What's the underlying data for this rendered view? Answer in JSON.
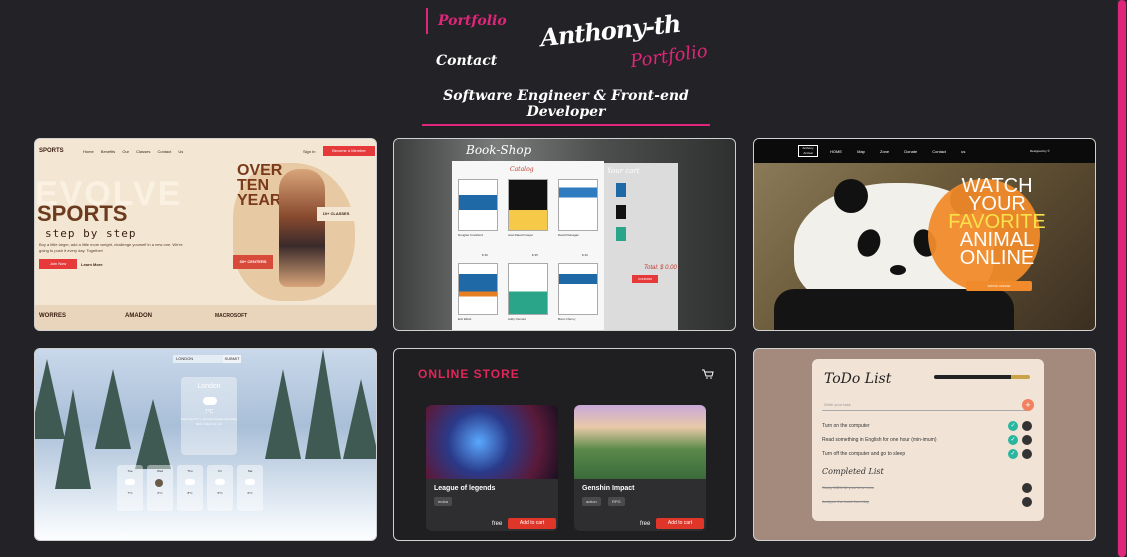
{
  "nav": {
    "portfolio": "Portfolio",
    "contact": "Contact"
  },
  "logo": {
    "main": "Anthony-th",
    "sub": "Portfolio"
  },
  "tagline": "Software Engineer & Front-end Developer",
  "colors": {
    "accent": "#e0267a",
    "background": "#232226"
  },
  "sports": {
    "brand": "SPORTS",
    "links": "Home Benefits Our Classes Contact Us",
    "signin": "Sign In",
    "member": "Become a Member",
    "evolve": "EVOLVE",
    "title": "SPORTS",
    "step": "step by step",
    "para": "Buy a little larger, add a little more weight, challenge yourself in a new one. We're going to push it every day. Together!",
    "join": "Join Now",
    "learn": "Learn More",
    "over": "OVER TEN YEARS",
    "classes": "10+ CLASSES",
    "centers": "30+ CENTERS",
    "brands": [
      "WORRES",
      "AMADON",
      "MACROSOFT"
    ]
  },
  "bookshop": {
    "title": "Book-Shop",
    "catalog": "Catalog",
    "cart_title": "Your cart",
    "books": [
      {
        "author": "Douglas Crockford",
        "title": "JavaScript: The Good Parts",
        "price": "$ 30"
      },
      {
        "author": "Axel Rauschmayer",
        "title": "Speaking JavaScript",
        "price": "$ 35"
      },
      {
        "author": "David Flanagan",
        "title": "HTTP: The Definitive Guide",
        "price": "$ 40"
      },
      {
        "author": "Eric Elliott",
        "title": "Programming JavaScript Applications",
        "price": "$ 25"
      },
      {
        "author": "Addy Osmani",
        "title": "Learning JavaScript Design Patterns",
        "price": "$ 30"
      },
      {
        "author": "Boris Cherny",
        "title": "Programming TypeScript",
        "price": "$ 40"
      }
    ],
    "total": "Total: $ 0.00",
    "checkout": "CONFIRM"
  },
  "panda": {
    "logo": "Anthony Animal",
    "links": "HOME Map Zone Donate Contact us",
    "designed": "Designed by ©",
    "line1": "WATCH",
    "line2": "YOUR",
    "line3": "FAVORITE",
    "line4": "ANIMAL",
    "line5": "ONLINE",
    "cta": "WATCH ONLINE"
  },
  "weather": {
    "search_value": "LONDON",
    "search_btn": "SUBMIT",
    "city": "London",
    "temp": "7°C",
    "details": "Feels like 5°C | overcast clouds | Humidity 82% | Wind 3.1 m/s",
    "forecast": [
      {
        "day": "Tue",
        "temp": "7°C"
      },
      {
        "day": "Wed",
        "temp": "6°C"
      },
      {
        "day": "Thu",
        "temp": "8°C"
      },
      {
        "day": "Fri",
        "temp": "5°C"
      },
      {
        "day": "Sat",
        "temp": "6°C"
      }
    ]
  },
  "store": {
    "title": "ONLINE STORE",
    "products": [
      {
        "name": "League of legends",
        "tags": [
          "moba"
        ],
        "price": "free",
        "button": "Add to cart"
      },
      {
        "name": "Genshin Impact",
        "tags": [
          "action",
          "RPG"
        ],
        "price": "free",
        "button": "Add to cart"
      }
    ]
  },
  "todo": {
    "title": "ToDo List",
    "placeholder": "Write your task",
    "tasks": [
      "Turn on the computer",
      "Read something in English for one hour (min-imum)",
      "Turn off the computer and go to sleep"
    ],
    "completed_title": "Completed List",
    "completed": [
      "Study MDN till your time runs",
      "Analyze the work from day"
    ]
  }
}
